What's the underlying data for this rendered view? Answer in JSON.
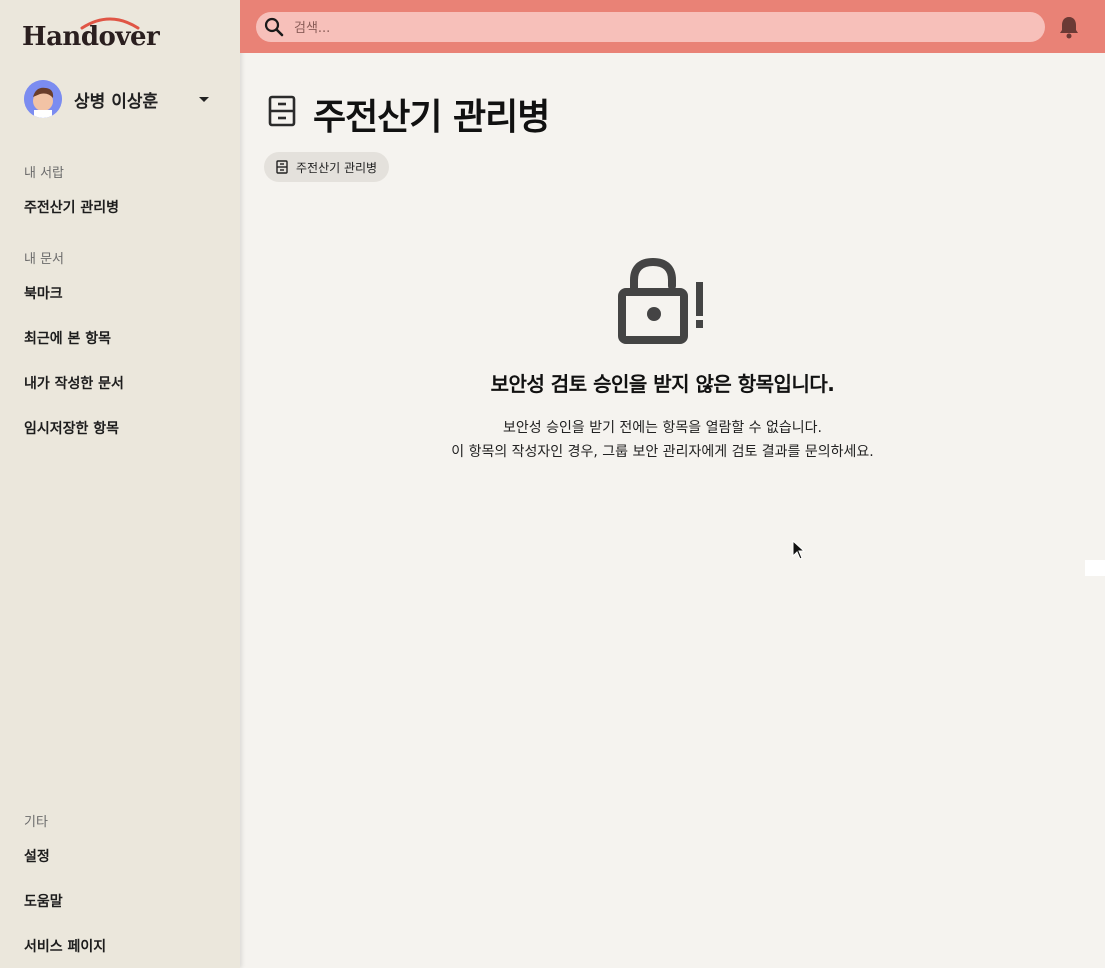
{
  "app": {
    "logo": "Handover",
    "brand_color": "#e98276"
  },
  "user": {
    "name": "상병 이상훈"
  },
  "sidebar": {
    "drawer": {
      "label": "내 서랍",
      "items": [
        {
          "label": "주전산기 관리병"
        }
      ]
    },
    "documents": {
      "label": "내 문서",
      "items": [
        {
          "label": "북마크"
        },
        {
          "label": "최근에 본 항목"
        },
        {
          "label": "내가 작성한 문서"
        },
        {
          "label": "임시저장한 항목"
        }
      ]
    },
    "other": {
      "label": "기타",
      "items": [
        {
          "label": "설정"
        },
        {
          "label": "도움말"
        },
        {
          "label": "서비스 페이지"
        }
      ]
    }
  },
  "search": {
    "placeholder": "검색..."
  },
  "page": {
    "title": "주전산기 관리병",
    "chip": "주전산기 관리병"
  },
  "message": {
    "title": "보안성 검토 승인을 받지 않은 항목입니다.",
    "line1": "보안성 승인을 받기 전에는 항목을 열람할 수 없습니다.",
    "line2": "이 항목의 작성자인 경우, 그룹 보안 관리자에게 검토 결과를 문의하세요."
  },
  "icons": [
    "search-icon",
    "bell-icon",
    "cabinet-icon",
    "unlock-alert-icon",
    "chevron-down-icon"
  ]
}
